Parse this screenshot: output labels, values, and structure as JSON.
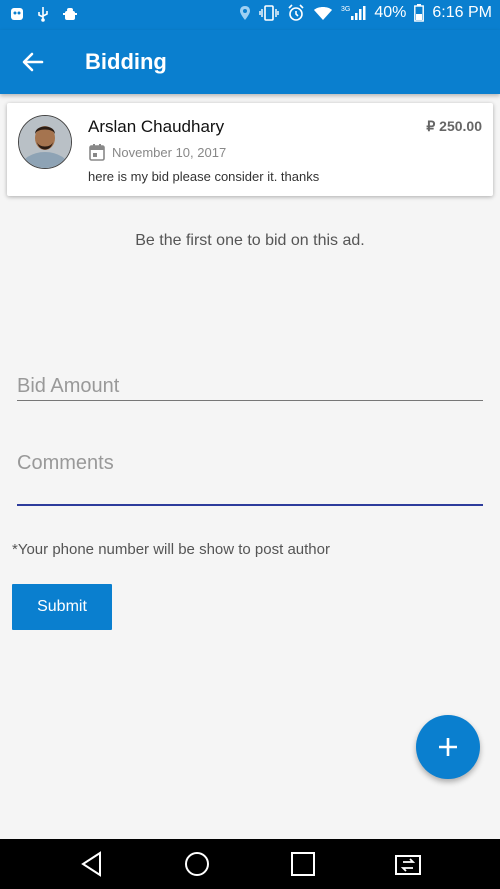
{
  "status_bar": {
    "battery": "40%",
    "time": "6:16 PM",
    "network": "3G",
    "icons": [
      "notification-icon",
      "usb-icon",
      "android-debug-icon",
      "location-icon",
      "vibrate-icon",
      "alarm-icon",
      "wifi-icon",
      "signal-icon",
      "battery-icon"
    ]
  },
  "app_bar": {
    "title": "Bidding",
    "back_icon": "arrow-back-icon"
  },
  "bid_card": {
    "name": "Arslan Chaudhary",
    "price": "₽ 250.00",
    "date": "November 10, 2017",
    "comment": "here is my bid please consider it. thanks"
  },
  "empty_message": "Be the first one to bid on this ad.",
  "form": {
    "bid_amount_placeholder": "Bid Amount",
    "comments_placeholder": "Comments",
    "note": "*Your phone number will be show to post author",
    "submit_label": "Submit"
  },
  "fab": {
    "icon": "plus-icon"
  },
  "nav_bar": {
    "icons": [
      "back-triangle-icon",
      "home-circle-icon",
      "recents-square-icon",
      "switch-app-icon"
    ]
  },
  "colors": {
    "primary": "#0a7fcf",
    "focus_underline": "#2d3c9c",
    "background": "#f5f5f5"
  }
}
